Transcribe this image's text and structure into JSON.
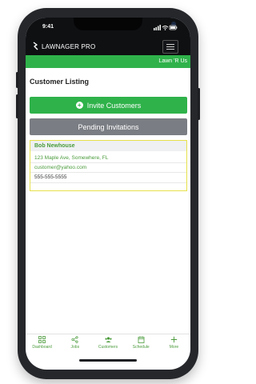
{
  "status": {
    "time": "9:41"
  },
  "header": {
    "brand": "LAWNAGER PRO",
    "menu_icon": "hamburger-icon"
  },
  "company_bar": {
    "company_name": "Lawn 'R Us"
  },
  "page": {
    "title": "Customer Listing"
  },
  "actions": {
    "invite_label": "Invite Customers",
    "pending_label": "Pending Invitations"
  },
  "customers": [
    {
      "name": "Bob Newhouse",
      "address": "123 Maple Ave, Somewhere, FL",
      "email": "customer@yahoo.com",
      "phone": "555-555-5555"
    }
  ],
  "tabs": [
    {
      "label": "Dashboard",
      "icon": "grid-icon"
    },
    {
      "label": "Jobs",
      "icon": "share-icon"
    },
    {
      "label": "Customers",
      "icon": "users-icon"
    },
    {
      "label": "Schedule",
      "icon": "calendar-icon"
    },
    {
      "label": "More",
      "icon": "plus-icon"
    }
  ],
  "colors": {
    "accent": "#2fb24a",
    "secondary": "#7a7d83",
    "highlight": "#e6e04a"
  }
}
